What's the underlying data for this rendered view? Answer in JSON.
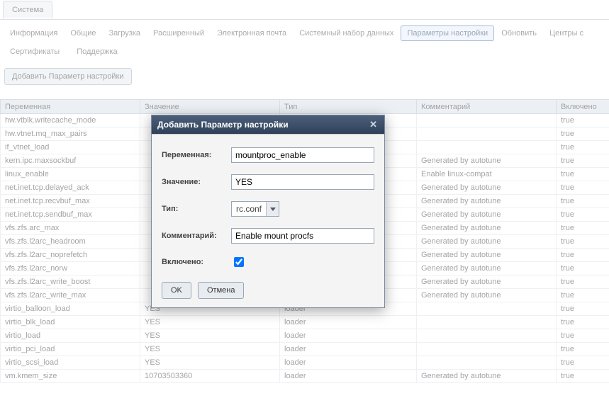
{
  "top_tab": "Система",
  "nav1": {
    "items": [
      "Информация",
      "Общие",
      "Загрузка",
      "Расширенный",
      "Электронная почта",
      "Системный набор данных",
      "Параметры настройки",
      "Обновить",
      "Центры с"
    ],
    "active_index": 6
  },
  "nav2": {
    "items": [
      "Сертификаты",
      "Поддержка"
    ]
  },
  "add_button": "Добавить Параметр настройки",
  "grid": {
    "columns": [
      "Переменная",
      "Значение",
      "Тип",
      "Комментарий",
      "Включено"
    ],
    "rows": [
      {
        "var": "hw.vtblk.writecache_mode",
        "val": "",
        "type": "",
        "comment": "",
        "enabled": "true"
      },
      {
        "var": "hw.vtnet.mq_max_pairs",
        "val": "",
        "type": "",
        "comment": "",
        "enabled": "true"
      },
      {
        "var": "if_vtnet_load",
        "val": "",
        "type": "",
        "comment": "",
        "enabled": "true"
      },
      {
        "var": "kern.ipc.maxsockbuf",
        "val": "",
        "type": "",
        "comment": "Generated by autotune",
        "enabled": "true"
      },
      {
        "var": "linux_enable",
        "val": "",
        "type": "",
        "comment": "Enable linux-compat",
        "enabled": "true"
      },
      {
        "var": "net.inet.tcp.delayed_ack",
        "val": "",
        "type": "",
        "comment": "Generated by autotune",
        "enabled": "true"
      },
      {
        "var": "net.inet.tcp.recvbuf_max",
        "val": "",
        "type": "",
        "comment": "Generated by autotune",
        "enabled": "true"
      },
      {
        "var": "net.inet.tcp.sendbuf_max",
        "val": "",
        "type": "",
        "comment": "Generated by autotune",
        "enabled": "true"
      },
      {
        "var": "vfs.zfs.arc_max",
        "val": "",
        "type": "",
        "comment": "Generated by autotune",
        "enabled": "true"
      },
      {
        "var": "vfs.zfs.l2arc_headroom",
        "val": "",
        "type": "",
        "comment": "Generated by autotune",
        "enabled": "true"
      },
      {
        "var": "vfs.zfs.l2arc_noprefetch",
        "val": "",
        "type": "",
        "comment": "Generated by autotune",
        "enabled": "true"
      },
      {
        "var": "vfs.zfs.l2arc_norw",
        "val": "",
        "type": "",
        "comment": "Generated by autotune",
        "enabled": "true"
      },
      {
        "var": "vfs.zfs.l2arc_write_boost",
        "val": "",
        "type": "",
        "comment": "Generated by autotune",
        "enabled": "true"
      },
      {
        "var": "vfs.zfs.l2arc_write_max",
        "val": "",
        "type": "",
        "comment": "Generated by autotune",
        "enabled": "true"
      },
      {
        "var": "virtio_balloon_load",
        "val": "YES",
        "type": "loader",
        "comment": "",
        "enabled": "true"
      },
      {
        "var": "virtio_blk_load",
        "val": "YES",
        "type": "loader",
        "comment": "",
        "enabled": "true"
      },
      {
        "var": "virtio_load",
        "val": "YES",
        "type": "loader",
        "comment": "",
        "enabled": "true"
      },
      {
        "var": "virtio_pci_load",
        "val": "YES",
        "type": "loader",
        "comment": "",
        "enabled": "true"
      },
      {
        "var": "virtio_scsi_load",
        "val": "YES",
        "type": "loader",
        "comment": "",
        "enabled": "true"
      },
      {
        "var": "vm.kmem_size",
        "val": "10703503360",
        "type": "loader",
        "comment": "Generated by autotune",
        "enabled": "true"
      }
    ]
  },
  "dialog": {
    "title": "Добавить Параметр настройки",
    "labels": {
      "variable": "Переменная:",
      "value": "Значение:",
      "type": "Тип:",
      "comment": "Комментарий:",
      "enabled": "Включено:"
    },
    "values": {
      "variable": "mountproc_enable",
      "value": "YES",
      "type": "rc.conf",
      "comment": "Enable mount procfs",
      "enabled": true
    },
    "buttons": {
      "ok": "OK",
      "cancel": "Отмена"
    }
  }
}
